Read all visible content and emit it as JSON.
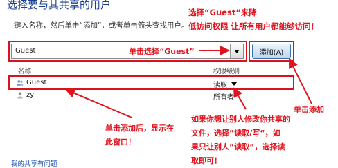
{
  "dialog": {
    "title": "选择要与其共享的用户",
    "instruction": "键入名称，然后单击“添加”，或者单击箭头查找用户。",
    "combo_value": "Guest",
    "add_button_label": "添加(A)",
    "columns": [
      "名称",
      "权限级别"
    ],
    "rows": [
      {
        "name": "Guest",
        "permission": "读取",
        "icon": "users-icon"
      },
      {
        "name": "zy",
        "permission": "所有者",
        "icon": "user-icon"
      }
    ],
    "footer_link": "我的共享有问题"
  },
  "annotations": {
    "top_right_line1": "选择“Guest”来降",
    "top_right_line2": "低访问权限 让所有用户都能够访问！",
    "combo_note": "单击选择“Guest”",
    "add_note": "单击添加",
    "left_note_line1": "单击添加后，显示在",
    "left_note_line2": "此窗口！",
    "right_note_line1": "如果你想让别人修改你共享的",
    "right_note_line2": "文件，选择”读取/写“，如",
    "right_note_line3": "果只让别人”读取“，选择读",
    "right_note_line4": "取即可！"
  },
  "colors": {
    "annotation_red": "#e0141e",
    "title_blue": "#1a3f8f",
    "link_blue": "#1a4fb0"
  }
}
